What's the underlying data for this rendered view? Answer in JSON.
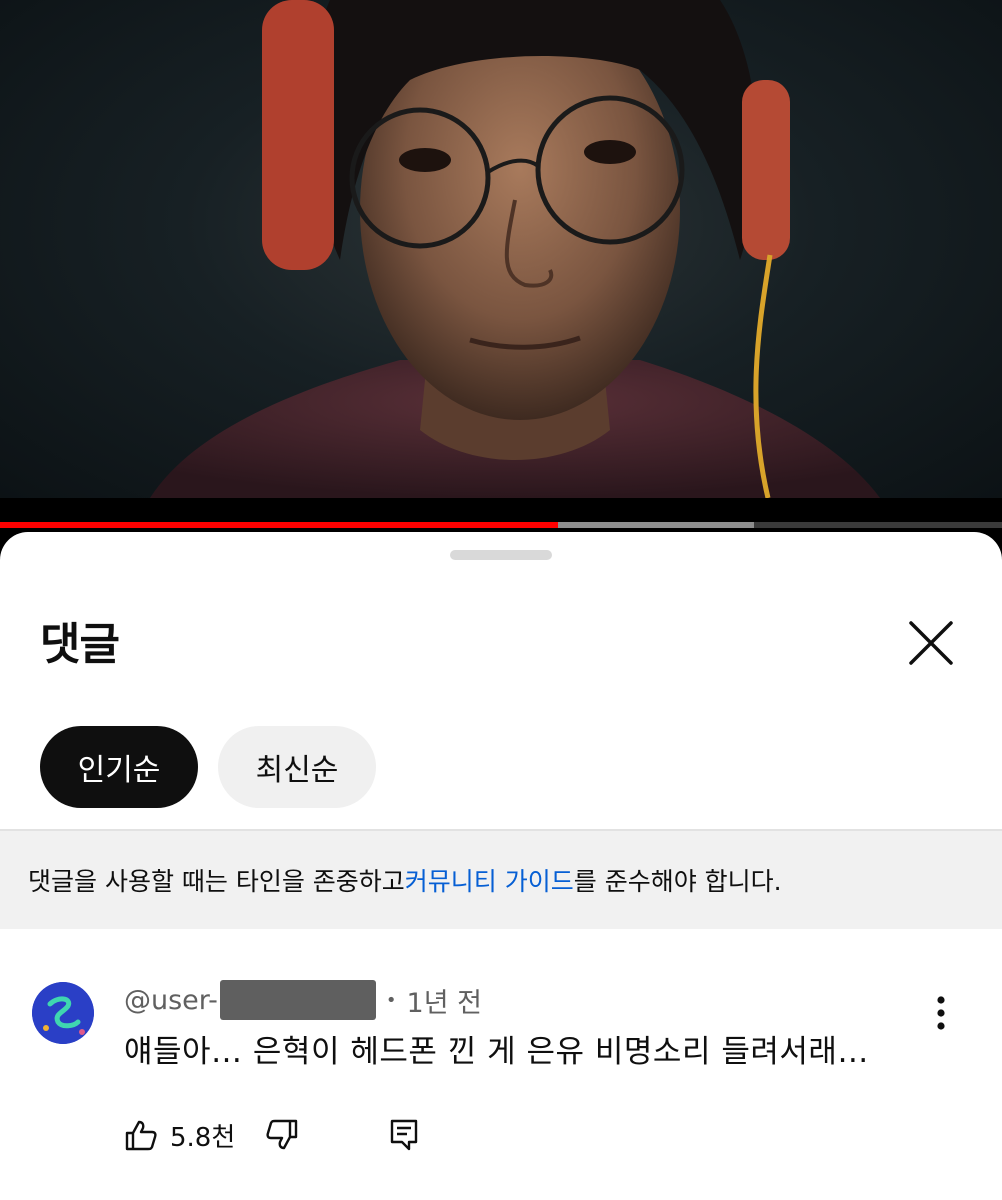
{
  "video": {
    "progress_played": 0.557,
    "progress_buffered": 0.752
  },
  "comments_panel": {
    "title": "댓글",
    "close_icon": "close-icon",
    "sort_chips": [
      {
        "label": "인기순",
        "selected": true
      },
      {
        "label": "최신순",
        "selected": false
      }
    ],
    "notice": {
      "before": "댓글을 사용할 때는 타인을 존중하고 ",
      "link": "커뮤니티 가이드",
      "after": "를 준수해야 합니다."
    }
  },
  "comment": {
    "author": "@user-",
    "separator": "•",
    "time": "1년 전",
    "text": "얘들아… 은혁이 헤드폰 낀 게 은유 비명소리 들려서래…",
    "like_count": "5.8천",
    "icons": {
      "like": "thumbs-up-icon",
      "dislike": "thumbs-down-icon",
      "reply": "reply-icon",
      "more": "more-vertical-icon"
    }
  },
  "colors": {
    "progress_red": "#ff0000",
    "link_blue": "#065fd4",
    "avatar_blue": "#2a3fc6"
  }
}
